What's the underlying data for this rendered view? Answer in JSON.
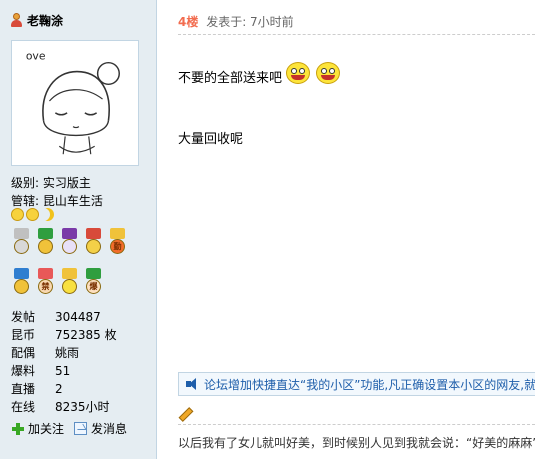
{
  "user": {
    "name": "老鞠涂",
    "avatar_text": "ove",
    "level_label": "级别:",
    "level_value": "实习版主",
    "manage_label": "管辖:",
    "manage_value": "昆山车生活"
  },
  "medals": {
    "row1": [
      {
        "icon": "medal-icon",
        "ribbon": "#c0c0c0",
        "coin": "#d8d8d8",
        "text": ""
      },
      {
        "icon": "medal-icon",
        "ribbon": "#2f9e3f",
        "coin": "#f0c23a",
        "text": ""
      },
      {
        "icon": "medal-icon",
        "ribbon": "#7a3aa8",
        "coin": "#e8e0f8",
        "text": ""
      },
      {
        "icon": "medal-icon",
        "ribbon": "#d84a3a",
        "coin": "#f3d048",
        "text": ""
      },
      {
        "icon": "medal-icon",
        "ribbon": "#f0c23a",
        "coin": "#f26c2a",
        "text": "勤"
      }
    ],
    "row2": [
      {
        "icon": "medal-icon",
        "ribbon": "#2f7ed0",
        "coin": "#f0c23a",
        "text": ""
      },
      {
        "icon": "medal-icon",
        "ribbon": "#e85858",
        "coin": "#f8d8b0",
        "text": "禁"
      },
      {
        "icon": "medal-icon",
        "ribbon": "#f0c23a",
        "coin": "#f8e040",
        "text": ""
      },
      {
        "icon": "medal-icon",
        "ribbon": "#2f9e3f",
        "coin": "#fde0c0",
        "text": "爆"
      }
    ]
  },
  "stats": [
    {
      "label": "发帖",
      "value": "304487"
    },
    {
      "label": "昆币",
      "value": "752385 枚"
    },
    {
      "label": "配偶",
      "value": "姚雨"
    },
    {
      "label": "爆料",
      "value": "51"
    },
    {
      "label": "直播",
      "value": "2"
    },
    {
      "label": "在线",
      "value": "8235小时"
    }
  ],
  "actions": {
    "follow": "加关注",
    "message": "发消息"
  },
  "post": {
    "floor": "4楼",
    "posted_at": "发表于: 7小时前",
    "line1": "不要的全部送来吧",
    "line2": "大量回收呢",
    "notice": "论坛增加快捷直达“我的小区”功能,凡正确设置本小区的网友,就"
  },
  "signature": "以后我有了女儿就叫好美，到时候别人见到我就会说：“好美的麻麻”"
}
